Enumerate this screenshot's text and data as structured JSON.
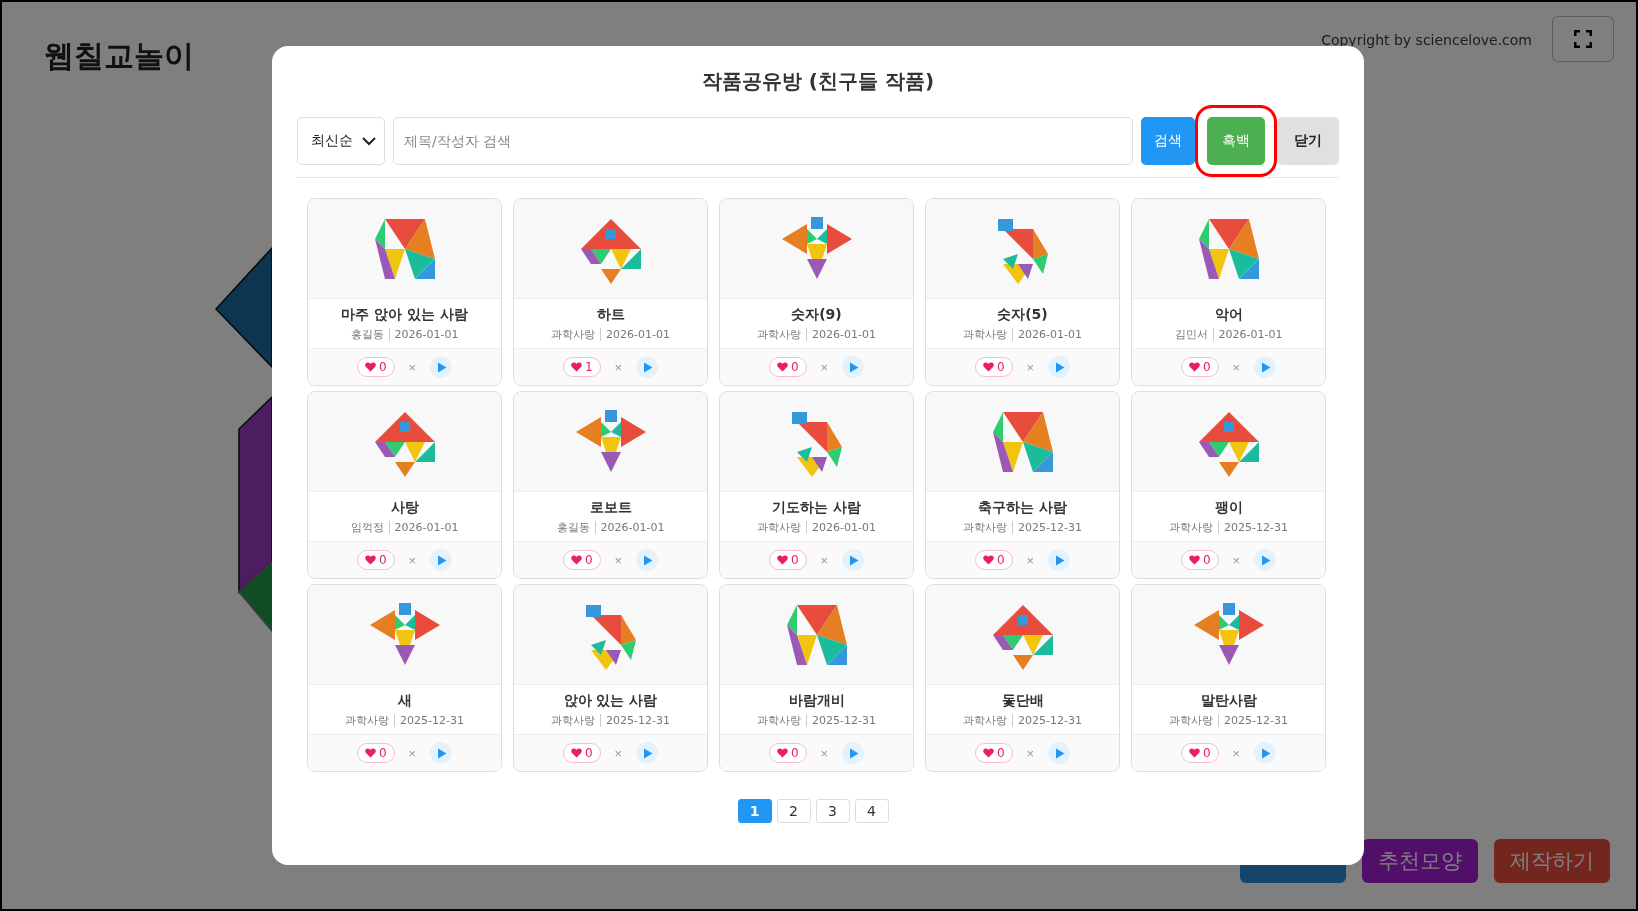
{
  "app": {
    "title": "웹칠교놀이",
    "copyright": "Copyright by sciencelove.com",
    "bottom_buttons": [
      {
        "kind": "list"
      },
      {
        "kind": "recommend",
        "label": "추천모양"
      },
      {
        "kind": "create",
        "label": "제작하기"
      }
    ]
  },
  "dialog": {
    "title": "작품공유방 (친구들 작품)",
    "sort": {
      "value": "최신순"
    },
    "search": {
      "placeholder": "제목/작성자 검색"
    },
    "buttons": [
      {
        "label": "검색",
        "kind": "primary",
        "highlighted": false
      },
      {
        "label": "흑백",
        "kind": "success",
        "highlighted": true
      },
      {
        "label": "닫기",
        "kind": "plain",
        "highlighted": false
      }
    ],
    "works": [
      {
        "title": "마주 앉아 있는 사람",
        "author": "홍길동",
        "date": "2026-01-01",
        "likes": "0",
        "remove": "×"
      },
      {
        "title": "하트",
        "author": "과학사랑",
        "date": "2026-01-01",
        "likes": "1",
        "remove": "×"
      },
      {
        "title": "숫자(9)",
        "author": "과학사랑",
        "date": "2026-01-01",
        "likes": "0",
        "remove": "×"
      },
      {
        "title": "숫자(5)",
        "author": "과학사랑",
        "date": "2026-01-01",
        "likes": "0",
        "remove": "×"
      },
      {
        "title": "악어",
        "author": "김민서",
        "date": "2026-01-01",
        "likes": "0",
        "remove": "×"
      },
      {
        "title": "사탕",
        "author": "임꺽정",
        "date": "2026-01-01",
        "likes": "0",
        "remove": "×"
      },
      {
        "title": "로보트",
        "author": "홍길동",
        "date": "2026-01-01",
        "likes": "0",
        "remove": "×"
      },
      {
        "title": "기도하는 사람",
        "author": "과학사랑",
        "date": "2026-01-01",
        "likes": "0",
        "remove": "×"
      },
      {
        "title": "축구하는 사람",
        "author": "과학사랑",
        "date": "2025-12-31",
        "likes": "0",
        "remove": "×"
      },
      {
        "title": "팽이",
        "author": "과학사랑",
        "date": "2025-12-31",
        "likes": "0",
        "remove": "×"
      },
      {
        "title": "새",
        "author": "과학사랑",
        "date": "2025-12-31",
        "likes": "0",
        "remove": "×"
      },
      {
        "title": "앉아 있는 사람",
        "author": "과학사랑",
        "date": "2025-12-31",
        "likes": "0",
        "remove": "×"
      },
      {
        "title": "바람개비",
        "author": "과학사랑",
        "date": "2025-12-31",
        "likes": "0",
        "remove": "×"
      },
      {
        "title": "돛단배",
        "author": "과학사랑",
        "date": "2025-12-31",
        "likes": "0",
        "remove": "×"
      },
      {
        "title": "말탄사람",
        "author": "과학사랑",
        "date": "2025-12-31",
        "likes": "0",
        "remove": "×"
      }
    ],
    "pages": [
      {
        "label": "1",
        "selected": true
      },
      {
        "label": "2",
        "selected": false
      },
      {
        "label": "3",
        "selected": false
      },
      {
        "label": "4",
        "selected": false
      }
    ]
  }
}
